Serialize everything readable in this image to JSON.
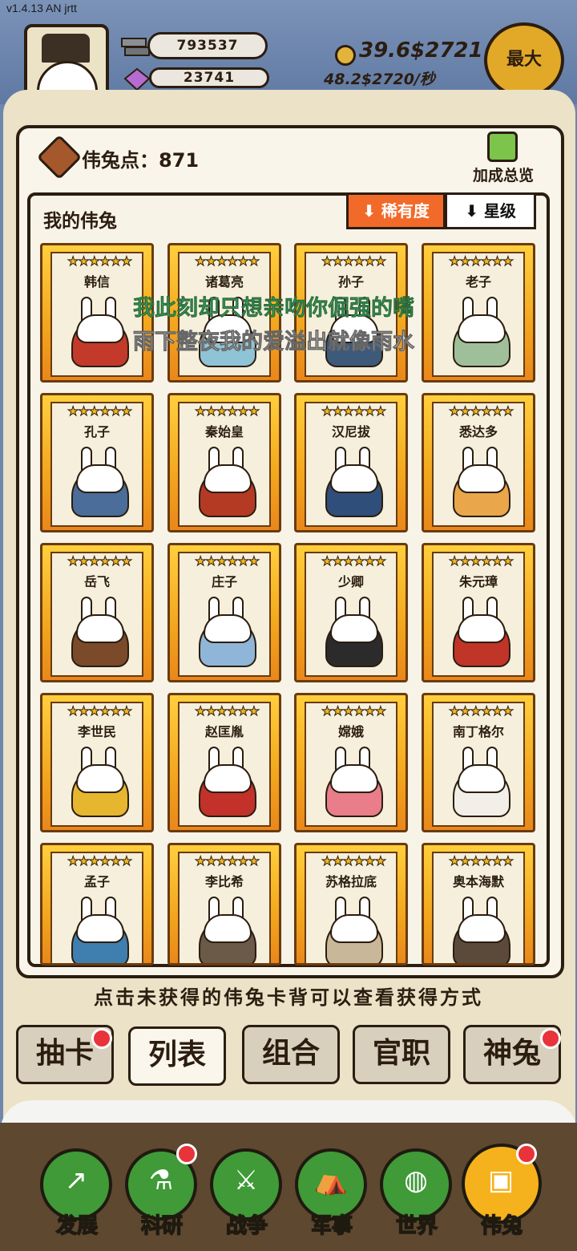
{
  "version": "v1.4.13 AN jrtt",
  "resources": {
    "silver": "793537",
    "gem": "23741",
    "gold": "39.6$2721",
    "gold_rate": "48.2$2720/秒",
    "max_label": "最大"
  },
  "panel": {
    "points_label": "伟兔点：871",
    "bonus_label": "加成总览",
    "list_title": "我的伟兔",
    "sort_rarity": "稀有度",
    "sort_star": "星级",
    "hint": "点击未获得的伟兔卡背可以查看获得方式"
  },
  "overlay": {
    "lyric_line1": "我此刻却只想亲吻你倔强的嘴",
    "lyric_line2": "雨下整夜我的爱溢出就像雨水"
  },
  "cards": [
    {
      "name": "韩信",
      "stars": "★★★★★★",
      "color": "#c33a2a"
    },
    {
      "name": "诸葛亮",
      "stars": "★★★★★★",
      "color": "#8fc3d6"
    },
    {
      "name": "孙子",
      "stars": "★★★★★★",
      "color": "#3d5a7a"
    },
    {
      "name": "老子",
      "stars": "★★★★★★",
      "color": "#9fbf9a"
    },
    {
      "name": "孔子",
      "stars": "★★★★★★",
      "color": "#4a6d9a"
    },
    {
      "name": "秦始皇",
      "stars": "★★★★★★",
      "color": "#b53a24"
    },
    {
      "name": "汉尼拔",
      "stars": "★★★★★★",
      "color": "#2f4e7a"
    },
    {
      "name": "悉达多",
      "stars": "★★★★★★",
      "color": "#e9a64a"
    },
    {
      "name": "岳飞",
      "stars": "★★★★★★",
      "color": "#7a4a2a"
    },
    {
      "name": "庄子",
      "stars": "★★★★★★",
      "color": "#8fb6d8"
    },
    {
      "name": "少卿",
      "stars": "★★★★★★",
      "color": "#2b2b2b"
    },
    {
      "name": "朱元璋",
      "stars": "★★★★★★",
      "color": "#c13428"
    },
    {
      "name": "李世民",
      "stars": "★★★★★★",
      "color": "#e6b62e"
    },
    {
      "name": "赵匡胤",
      "stars": "★★★★★★",
      "color": "#c2322a"
    },
    {
      "name": "嫦娥",
      "stars": "★★★★★★",
      "color": "#e97d8a"
    },
    {
      "name": "南丁格尔",
      "stars": "★★★★★★",
      "color": "#f2efe8"
    },
    {
      "name": "孟子",
      "stars": "★★★★★★",
      "color": "#3e7fb0"
    },
    {
      "name": "李比希",
      "stars": "★★★★★★",
      "color": "#6b5a48"
    },
    {
      "name": "苏格拉底",
      "stars": "★★★★★★",
      "color": "#c9b79a"
    },
    {
      "name": "奥本海默",
      "stars": "★★★★★★",
      "color": "#5b4a3a"
    }
  ],
  "subtabs": [
    "抽卡",
    "列表",
    "组合",
    "官职",
    "神兔"
  ],
  "nav": [
    "发展",
    "科研",
    "战争",
    "军事",
    "世界",
    "伟兔"
  ],
  "colors": {
    "accent_orange": "#f26a2a",
    "nav_green": "#3f9a37",
    "nav_active": "#f6b21c",
    "badge_red": "#e8333a"
  }
}
